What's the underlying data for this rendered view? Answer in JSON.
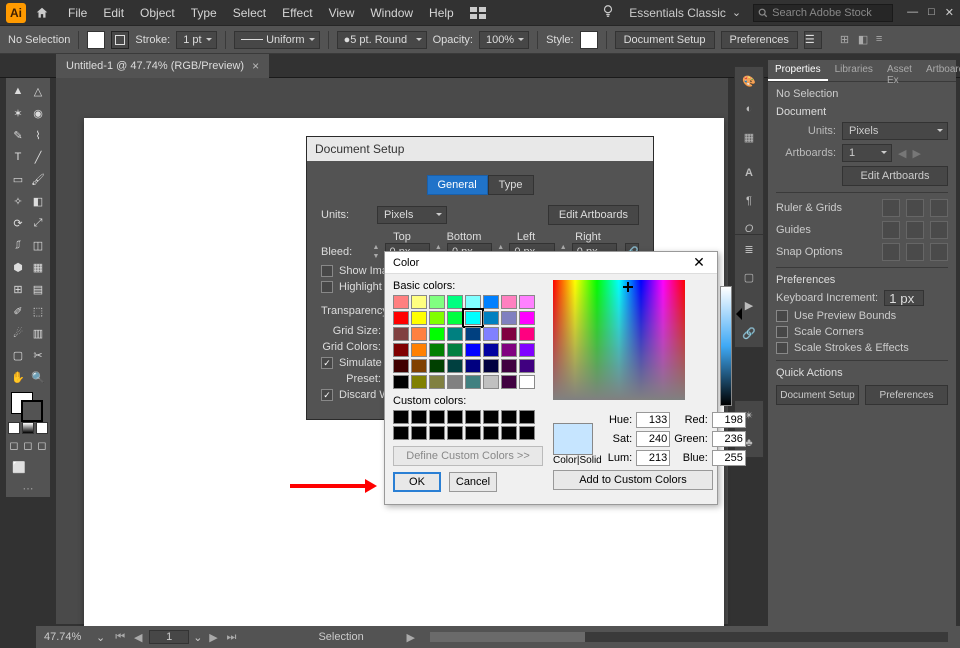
{
  "menu": {
    "items": [
      "File",
      "Edit",
      "Object",
      "Type",
      "Select",
      "Effect",
      "View",
      "Window",
      "Help"
    ],
    "workspace": "Essentials Classic",
    "search_placeholder": "Search Adobe Stock"
  },
  "optbar": {
    "noSelection": "No Selection",
    "stroke": "Stroke:",
    "strokeVal": "1 pt",
    "variable": "Uniform",
    "brush": "5 pt. Round",
    "opacity": "Opacity:",
    "opacityVal": "100%",
    "style": "Style:",
    "docSetup": "Document Setup",
    "prefs": "Preferences"
  },
  "tab": {
    "title": "Untitled-1 @ 47.74% (RGB/Preview)"
  },
  "rpanel": {
    "tabs": [
      "Properties",
      "Libraries",
      "Asset Ex",
      "Artboard"
    ],
    "noSel": "No Selection",
    "docHdr": "Document",
    "units": "Units:",
    "unitsVal": "Pixels",
    "artboards": "Artboards:",
    "artVal": "1",
    "editArt": "Edit Artboards",
    "ruler": "Ruler & Grids",
    "guides": "Guides",
    "snap": "Snap Options",
    "prefs": "Preferences",
    "kbd": "Keyboard Increment:",
    "kbdVal": "1 px",
    "c1": "Use Preview Bounds",
    "c2": "Scale Corners",
    "c3": "Scale Strokes & Effects",
    "qa": "Quick Actions",
    "qDoc": "Document Setup",
    "qPref": "Preferences"
  },
  "status": {
    "zoom": "47.74%",
    "page": "1",
    "tool": "Selection"
  },
  "docsetup": {
    "title": "Document Setup",
    "tabGeneral": "General",
    "tabType": "Type",
    "units": "Units:",
    "unitsVal": "Pixels",
    "editArt": "Edit Artboards",
    "top": "Top",
    "bottom": "Bottom",
    "left": "Left",
    "right": "Right",
    "bleed": "Bleed:",
    "bleedVal": "0 px",
    "showImg": "Show Imag",
    "highlight": "Highlight S",
    "transp": "Transparency a",
    "gridSize": "Grid Size:",
    "gridColors": "Grid Colors:",
    "simulate": "Simulate Co",
    "preset": "Preset:",
    "discard": "Discard Wh"
  },
  "color": {
    "title": "Color",
    "basic": "Basic colors:",
    "custom": "Custom colors:",
    "define": "Define Custom Colors >>",
    "ok": "OK",
    "cancel": "Cancel",
    "colorsolid": "Color|Solid",
    "hue": "Hue:",
    "sat": "Sat:",
    "lum": "Lum:",
    "red": "Red:",
    "green": "Green:",
    "blue": "Blue:",
    "hueV": "133",
    "satV": "240",
    "lumV": "213",
    "redV": "198",
    "greenV": "236",
    "blueV": "255",
    "add": "Add to Custom Colors",
    "basicColors": [
      "#ff8080",
      "#ffff80",
      "#80ff80",
      "#00ff80",
      "#80ffff",
      "#0080ff",
      "#ff80c0",
      "#ff80ff",
      "#ff0000",
      "#ffff00",
      "#80ff00",
      "#00ff40",
      "#00ffff",
      "#0080c0",
      "#8080c0",
      "#ff00ff",
      "#804040",
      "#ff8040",
      "#00ff00",
      "#008080",
      "#004080",
      "#8080ff",
      "#800040",
      "#ff0080",
      "#800000",
      "#ff8000",
      "#008000",
      "#008040",
      "#0000ff",
      "#0000a0",
      "#800080",
      "#8000ff",
      "#400000",
      "#804000",
      "#004000",
      "#004040",
      "#000080",
      "#000040",
      "#400040",
      "#400080",
      "#000000",
      "#808000",
      "#808040",
      "#808080",
      "#408080",
      "#c0c0c0",
      "#400040",
      "#ffffff"
    ],
    "selectedIndex": 12
  }
}
